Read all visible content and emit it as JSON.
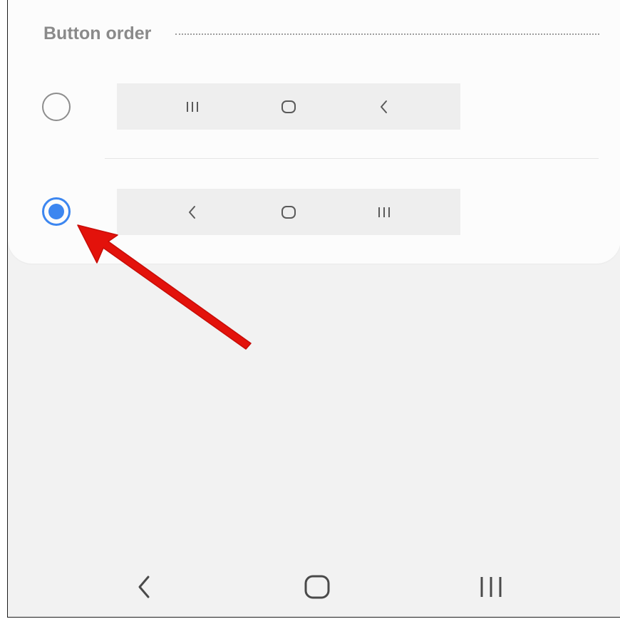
{
  "section": {
    "title": "Button order"
  },
  "options": [
    {
      "selected": false,
      "buttons": [
        "recents-icon",
        "home-icon",
        "back-icon"
      ]
    },
    {
      "selected": true,
      "buttons": [
        "back-icon",
        "home-icon",
        "recents-icon"
      ]
    }
  ],
  "navbar": {
    "buttons": [
      "back-icon",
      "home-icon",
      "recents-icon"
    ]
  },
  "colors": {
    "accent": "#3c86f0",
    "annotation_arrow": "#e3120b",
    "card_background": "#fcfcfc",
    "screen_background": "#f2f2f2",
    "preview_background": "#eeeeee"
  }
}
